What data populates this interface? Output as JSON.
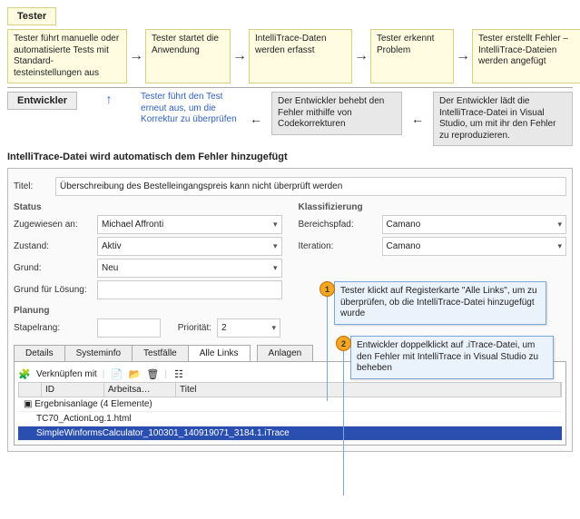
{
  "roles": {
    "tester": "Tester",
    "developer": "Entwickler"
  },
  "flow": {
    "b1": "Tester führt manuelle oder automatisierte Tests mit Standard-testeinstellungen aus",
    "b2": "Tester startet die Anwendung",
    "b3": "IntelliTrace-Daten werden erfasst",
    "b4": "Tester erkennt Problem",
    "b5": "Tester erstellt Fehler – IntelliTrace-Dateien werden angefügt",
    "note": "Tester führt den Test erneut aus, um die Korrektur zu überprüfen",
    "d1": "Der Entwickler behebt den Fehler mithilfe von Codekorrekturen",
    "d2": "Der Entwickler lädt die IntelliTrace-Datei in Visual Studio, um mit ihr den Fehler zu reproduzieren."
  },
  "heading": "IntelliTrace-Datei wird automatisch dem Fehler hinzugefügt",
  "form": {
    "titleLabel": "Titel:",
    "titleValue": "Überschreibung des Bestelleingangspreis kann nicht überprüft werden",
    "statusSection": "Status",
    "assignedLabel": "Zugewiesen an:",
    "assignedValue": "Michael Affronti",
    "stateLabel": "Zustand:",
    "stateValue": "Aktiv",
    "reasonLabel": "Grund:",
    "reasonValue": "Neu",
    "resolveLabel": "Grund für Lösung:",
    "resolveValue": "",
    "classSection": "Klassifizierung",
    "areaLabel": "Bereichspfad:",
    "areaValue": "Camano",
    "iterLabel": "Iteration:",
    "iterValue": "Camano",
    "planSection": "Planung",
    "stackLabel": "Stapelrang:",
    "stackValue": "",
    "prioLabel": "Priorität:",
    "prioValue": "2"
  },
  "tabs": {
    "details": "Details",
    "sysinfo": "Systeminfo",
    "testcases": "Testfälle",
    "alllinks": "Alle Links",
    "attachments": "Anlagen"
  },
  "toolbar": {
    "linkWith": "Verknüpfen mit"
  },
  "grid": {
    "cols": {
      "id": "ID",
      "worki": "Arbeitsa…",
      "title": "Titel"
    },
    "group": "Ergebnisanlage (4 Elemente)",
    "rows": [
      "TC70_ActionLog.1.html",
      "SimpleWinformsCalculator_100301_140919071_3184.1.iTrace"
    ]
  },
  "callouts": {
    "c1": "Tester klickt auf Registerkarte \"Alle Links\", um zu überprüfen, ob die IntelliTrace-Datei hinzugefügt wurde",
    "c2": "Entwickler doppelklickt auf .iTrace-Datei, um den Fehler mit IntelliTrace in Visual Studio zu beheben"
  }
}
